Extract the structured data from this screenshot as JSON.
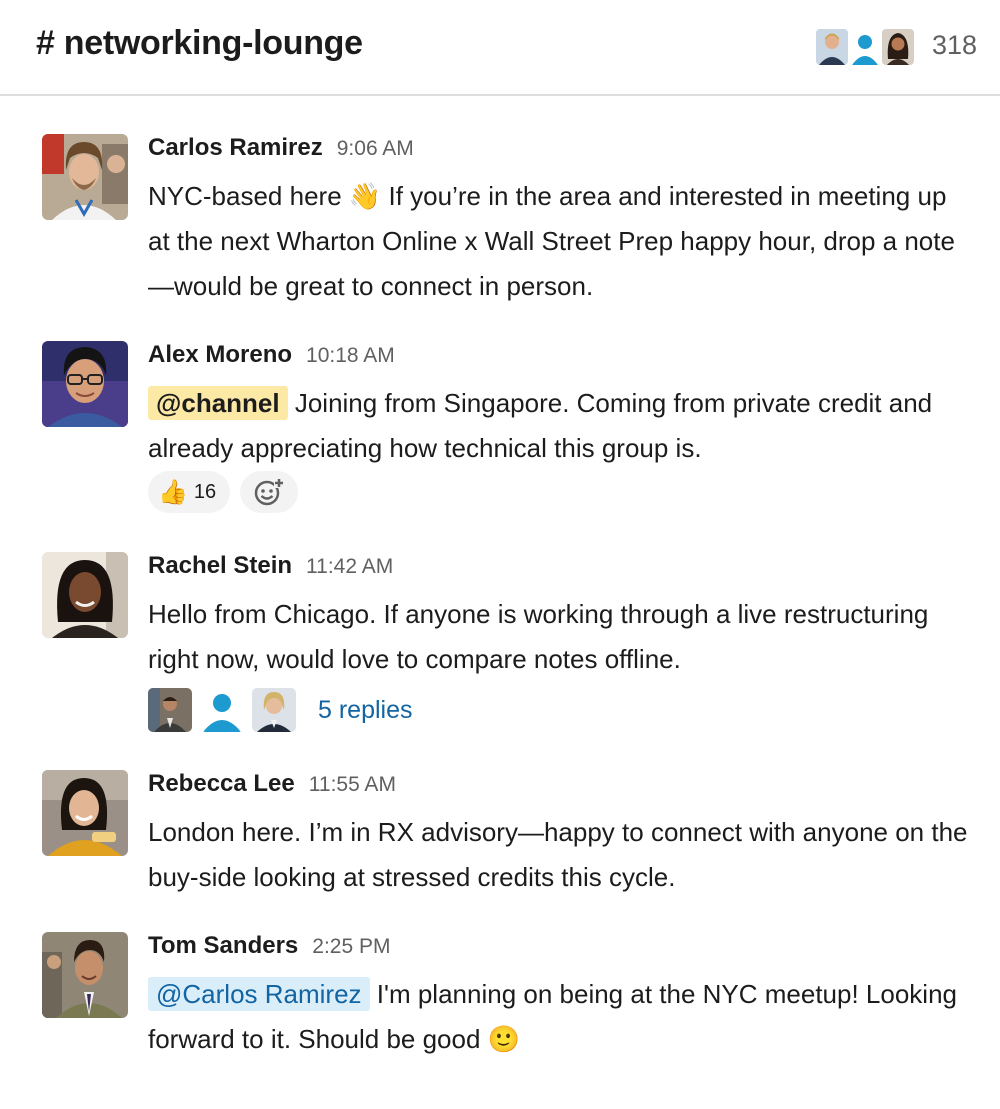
{
  "channel": {
    "name": "# networking-lounge",
    "member_count": "318"
  },
  "colors": {
    "mention_channel_bg": "#fde9a6",
    "mention_user_bg": "#daeef9",
    "link": "#1264a3",
    "timestamp": "#616061"
  },
  "messages": [
    {
      "author": "Carlos Ramirez",
      "time": "9:06 AM",
      "text_before": "NYC-based here ",
      "emoji": "👋",
      "text_after": " If you’re in the area and interested in meeting up at the next Wharton Online x Wall Street Prep happy hour, drop a note—would be great to connect in person."
    },
    {
      "author": "Alex Moreno",
      "time": "10:18 AM",
      "mention": "@channel",
      "text": " Joining from Singapore. Coming from private credit and already appreciating how technical this group is.",
      "reaction": {
        "icon": "thumbs-up-icon",
        "emoji": "👍",
        "count": "16"
      },
      "add_reaction_icon": "add-reaction-icon"
    },
    {
      "author": "Rachel Stein",
      "time": "11:42 AM",
      "text": "Hello from Chicago. If anyone is working through a live restructuring right now, would love to compare notes offline.",
      "replies": "5 replies"
    },
    {
      "author": "Rebecca Lee",
      "time": "11:55 AM",
      "text": "London here. I’m in RX advisory—happy to connect with anyone on the buy-side looking at stressed credits this cycle."
    },
    {
      "author": "Tom Sanders",
      "time": "2:25 PM",
      "mention": "@Carlos Ramirez",
      "text": " I'm planning on being at the NYC meetup! Looking forward to it. Should be good ",
      "emoji": "🙂"
    }
  ]
}
